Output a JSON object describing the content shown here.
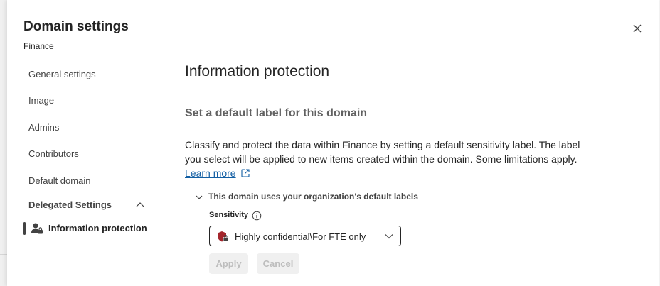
{
  "panel": {
    "title": "Domain settings",
    "subtitle": "Finance"
  },
  "nav": {
    "items": [
      {
        "label": "General settings"
      },
      {
        "label": "Image"
      },
      {
        "label": "Admins"
      },
      {
        "label": "Contributors"
      },
      {
        "label": "Default domain"
      }
    ],
    "group": {
      "label": "Delegated Settings",
      "expanded": true
    },
    "sub_item": {
      "label": "Information protection",
      "selected": true
    }
  },
  "main": {
    "title": "Information protection",
    "section_title": "Set a default label for this domain",
    "description": "Classify and protect the data within Finance by setting a default sensitivity label. The label you select will be applied to new items created within the domain. Some limitations apply.",
    "learn_more": "Learn more",
    "expander_label": "This domain uses your organization's default labels",
    "sensitivity_label": "Sensitivity",
    "sensitivity_value": "Highly confidential\\For FTE only",
    "apply_label": "Apply",
    "cancel_label": "Cancel"
  },
  "colors": {
    "accent_link": "#115ea3",
    "shield": "#a4262c",
    "disabled_text": "#bdbdbd",
    "disabled_bg": "#f0f0f0"
  },
  "icons": {
    "close": "close-icon",
    "chevron_up": "chevron-up-icon",
    "person_lock": "person-lock-icon",
    "external_link": "external-link-icon",
    "chevron_down_small": "chevron-down-icon",
    "info": "info-icon",
    "shield": "shield-lock-icon",
    "dropdown_caret": "chevron-down-icon"
  }
}
